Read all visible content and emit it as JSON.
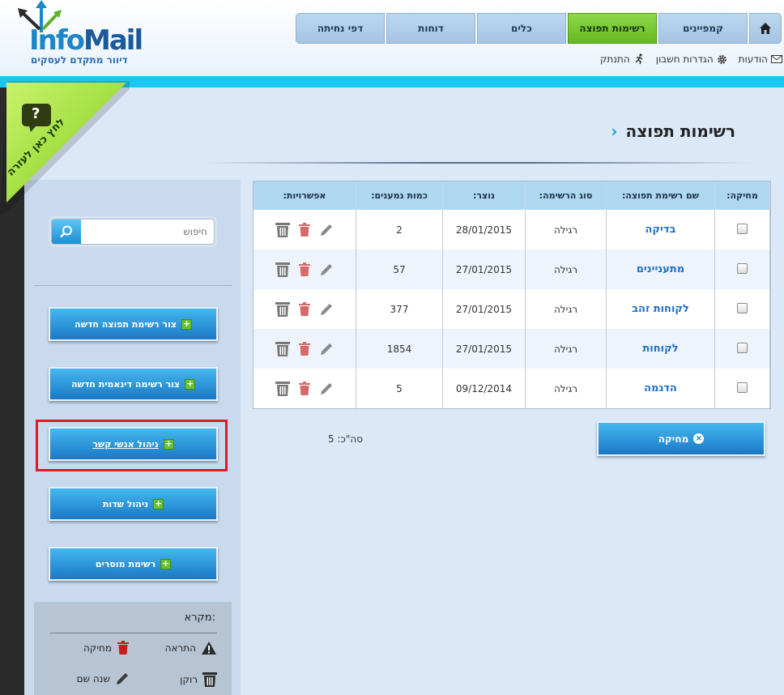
{
  "logo": {
    "part1": "Info",
    "part2": "Mail",
    "tagline": "דיוור מתקדם לעסקים"
  },
  "nav": {
    "home_icon": "home-icon",
    "tabs": [
      {
        "label": "קמפיינים"
      },
      {
        "label": "רשימות תפוצה",
        "active": true
      },
      {
        "label": "כלים"
      },
      {
        "label": "דוחות"
      },
      {
        "label": "דפי נחיתה"
      }
    ]
  },
  "util_links": {
    "messages": "הודעות",
    "account_settings": "הגדרות חשבון",
    "logout": "התנתק"
  },
  "help": {
    "label": "לחץ כאן לעזרה",
    "icon": "?"
  },
  "page": {
    "title": "רשימות תפוצה"
  },
  "search": {
    "placeholder": "חיפוש"
  },
  "sidebar": {
    "buttons": [
      "צור רשימת תפוצה חדשה",
      "צור רשימה דינאמית חדשה",
      "ניהול אנשי קשר",
      "ניהול שדות",
      "רשימת מוסרים"
    ]
  },
  "legend": {
    "title": "מקרא:",
    "warning": "התראה",
    "delete": "מחיקה",
    "empty": "רוקן",
    "rename": "שנה שם"
  },
  "table": {
    "headers": {
      "delete": "מחיקה:",
      "name": "שם רשימת תפוצה:",
      "type": "סוג הרשימה:",
      "created": "נוצר:",
      "count": "כמות נמענים:",
      "options": "אפשרויות:"
    },
    "rows": [
      {
        "name": "בדיקה",
        "type": "רגילה",
        "created": "28/01/2015",
        "count": "2"
      },
      {
        "name": "מתעניינים",
        "type": "רגילה",
        "created": "27/01/2015",
        "count": "57"
      },
      {
        "name": "לקוחות זהב",
        "type": "רגילה",
        "created": "27/01/2015",
        "count": "377"
      },
      {
        "name": "לקוחות",
        "type": "רגילה",
        "created": "27/01/2015",
        "count": "1854"
      },
      {
        "name": "הדגמה",
        "type": "רגילה",
        "created": "09/12/2014",
        "count": "5"
      }
    ]
  },
  "delete_button": {
    "label": "מחיקה"
  },
  "total": {
    "text": "סה\"כ: 5"
  },
  "colors": {
    "accent": "#1cc6f2",
    "active_tab": "#65b821",
    "highlight": "#e0182a",
    "button": "#1b78c5"
  }
}
